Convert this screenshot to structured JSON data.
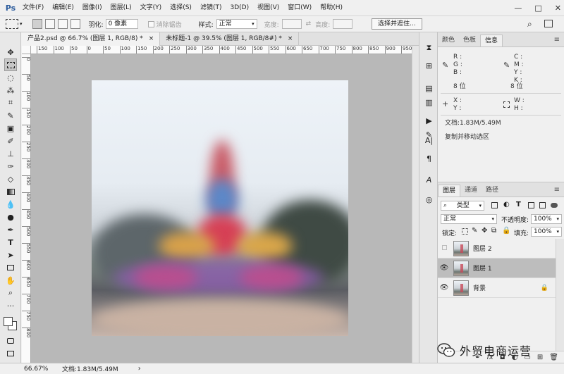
{
  "app": {
    "logo": "Ps"
  },
  "menu": [
    "文件(F)",
    "编辑(E)",
    "图像(I)",
    "图层(L)",
    "文字(Y)",
    "选择(S)",
    "滤镜(T)",
    "3D(D)",
    "视图(V)",
    "窗口(W)",
    "帮助(H)"
  ],
  "window_controls": {
    "minimize": "—",
    "maximize": "□",
    "close": "✕"
  },
  "options": {
    "feather_label": "羽化:",
    "feather_value": "0 像素",
    "antialias_label": "消除锯齿",
    "style_label": "样式:",
    "style_value": "正常",
    "width_label": "宽度:",
    "height_label": "高度:",
    "select_mask_button": "选择并遮住..."
  },
  "doc_tabs": [
    {
      "label": "产品2.psd @ 66.7% (图层 1, RGB/8) *",
      "close": "×"
    },
    {
      "label": "未标题-1 @ 39.5% (图层 1, RGB/8#) *",
      "close": "×"
    }
  ],
  "ruler": {
    "h_ticks": [
      "150",
      "100",
      "50",
      "0",
      "50",
      "100",
      "150",
      "200",
      "250",
      "300",
      "350",
      "400",
      "450",
      "500",
      "550",
      "600",
      "650",
      "700",
      "750",
      "800",
      "850",
      "900",
      "950"
    ],
    "v_ticks": [
      "0",
      "50",
      "100",
      "150",
      "200",
      "250",
      "300",
      "350",
      "400",
      "450",
      "500",
      "550",
      "600",
      "650",
      "700",
      "750",
      "800"
    ]
  },
  "status": {
    "zoom": "66.67%",
    "doc": "文档:1.83M/5.49M",
    "arrow": "›"
  },
  "info_panel": {
    "tabs": [
      "颜色",
      "色板",
      "信息"
    ],
    "active_tab": 2,
    "rgb_labels": [
      "R :",
      "G :",
      "B :"
    ],
    "cmyk_labels": [
      "C :",
      "M :",
      "Y :",
      "K :"
    ],
    "bit_left": "8 位",
    "bit_right": "8 位",
    "xy_labels": [
      "X :",
      "Y :"
    ],
    "wh_labels": [
      "W :",
      "H :"
    ],
    "doc_size": "文档:1.83M/5.49M",
    "hint": "复制并移动选区"
  },
  "layers_panel": {
    "tabs": [
      "图层",
      "通道",
      "路径"
    ],
    "active_tab": 0,
    "filter_kind": "类型",
    "blend_mode": "正常",
    "opacity_label": "不透明度:",
    "opacity_value": "100%",
    "lock_label": "锁定:",
    "fill_label": "填充:",
    "fill_value": "100%",
    "layers": [
      {
        "name": "图层 2",
        "visible": false,
        "selected": false,
        "locked": false
      },
      {
        "name": "图层 1",
        "visible": true,
        "selected": true,
        "locked": false
      },
      {
        "name": "背景",
        "visible": true,
        "selected": false,
        "locked": true
      }
    ]
  },
  "watermark": {
    "text": "外贸电商运营"
  }
}
